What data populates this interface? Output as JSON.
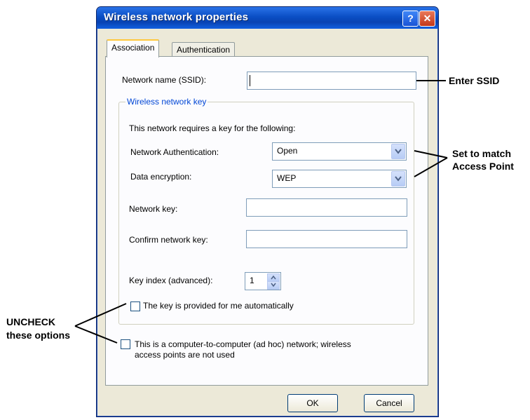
{
  "window": {
    "title": "Wireless network properties",
    "help_glyph": "?",
    "close_glyph": "✕"
  },
  "tabs": [
    {
      "label": "Association",
      "active": true
    },
    {
      "label": "Authentication",
      "active": false
    }
  ],
  "form": {
    "ssid_label": "Network name (SSID):",
    "ssid_value": "",
    "group_title": "Wireless network key",
    "requires_text": "This network requires a key for the following:",
    "auth_label": "Network Authentication:",
    "auth_value": "Open",
    "enc_label": "Data encryption:",
    "enc_value": "WEP",
    "netkey_label": "Network key:",
    "netkey_value": "",
    "confirm_label": "Confirm network key:",
    "confirm_value": "",
    "keyindex_label": "Key index (advanced):",
    "keyindex_value": "1",
    "auto_key_label": "The key is provided for me automatically",
    "auto_key_checked": false,
    "adhoc_label_line1": "This is a computer-to-computer (ad hoc) network; wireless",
    "adhoc_label_line2": "access points are not used",
    "adhoc_checked": false
  },
  "buttons": {
    "ok": "OK",
    "cancel": "Cancel"
  },
  "annotations": {
    "enter_ssid": "Enter SSID",
    "set_match_1": "Set to match",
    "set_match_2": "Access Point",
    "uncheck_1": "UNCHECK",
    "uncheck_2": "these options"
  },
  "colors": {
    "titlebar": "#0a4ec4",
    "group_title": "#0046d5",
    "tab_highlight": "#ffc83c"
  }
}
